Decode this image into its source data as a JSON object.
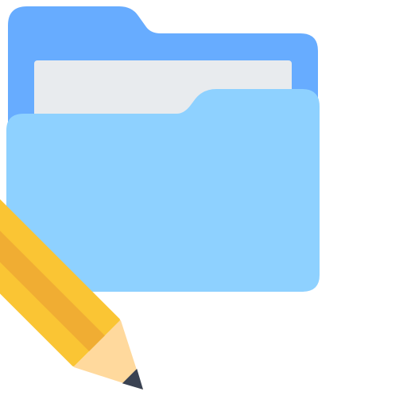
{
  "icon": {
    "name": "edit-folder-icon",
    "parts": {
      "folder": "folder-icon",
      "pencil": "pencil-icon"
    }
  },
  "colors": {
    "folder_back": "#67acff",
    "paper": "#e8ebee",
    "folder_front": "#8ed1ff",
    "pencil_body": "#fac534",
    "pencil_shade": "#f0ad33",
    "eraser": "#e4404b",
    "ferrule": "#e8ebee",
    "wood": "#ffd99d",
    "lead": "#3a4252"
  }
}
